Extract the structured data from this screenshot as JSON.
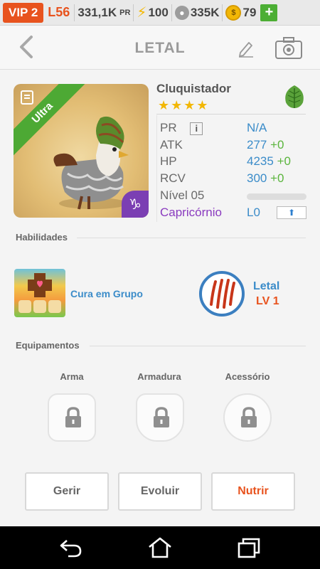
{
  "topbar": {
    "vip": "VIP 2",
    "level": "L56",
    "pr_value": "331,1K",
    "pr_unit": "PR",
    "energy": "100",
    "paw": "335K",
    "coins": "79",
    "plus": "+"
  },
  "header": {
    "title": "LETAL"
  },
  "card": {
    "ribbon": "Ultra",
    "zodiac_badge": "♑"
  },
  "monster": {
    "name": "Cluquistador",
    "stars": "★★★★",
    "element_icon": "leaf-icon",
    "stats": [
      {
        "label": "PR",
        "value": "N/A",
        "bonus": ""
      },
      {
        "label": "ATK",
        "value": "277",
        "bonus": "+0"
      },
      {
        "label": "HP",
        "value": "4235",
        "bonus": "+0"
      },
      {
        "label": "RCV",
        "value": "300",
        "bonus": "+0"
      }
    ],
    "info_button": "i",
    "level_label": "Nível 05",
    "level_progress": 0,
    "zodiac": "Capricórnio",
    "zodiac_level": "L0",
    "upgrade_arrow": "⬆"
  },
  "skills": {
    "label": "Habilidades",
    "group_skill": "Cura em Grupo",
    "passive_name": "Letal",
    "passive_level": "LV 1"
  },
  "equipment": {
    "label": "Equipamentos",
    "slots": [
      "Arma",
      "Armadura",
      "Acessório"
    ]
  },
  "actions": {
    "manage": "Gerir",
    "evolve": "Evoluir",
    "feed": "Nutrir"
  },
  "colors": {
    "accent": "#e8531e",
    "blue_value": "#3b8cc9",
    "green_bonus": "#5bb53d",
    "ultra_green": "#4da934",
    "zodiac_purple": "#8a3bbf"
  }
}
